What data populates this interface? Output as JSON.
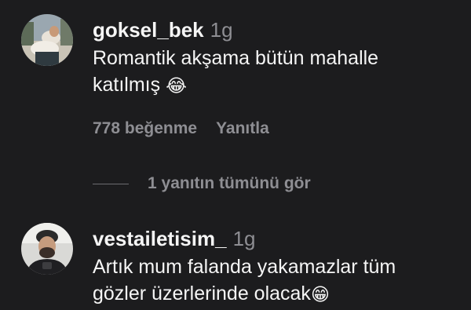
{
  "comments": [
    {
      "username": "goksel_bek",
      "time": "1g",
      "text_line1": "Romantik akşama bütün mahalle",
      "text_line2": "katılmış",
      "emoji": "😂",
      "likes": "778 beğenme",
      "reply_label": "Yanıtla",
      "avatar_icon": "person-avatar-icon"
    },
    {
      "username": "vestailetisim_",
      "time": "1g",
      "text_line1": "Artık mum falanda yakamazlar tüm",
      "text_line2": "gözler üzerlerinde olacak",
      "emoji": "😁",
      "avatar_icon": "person-avatar-icon"
    }
  ],
  "view_replies": "1 yanıtın tümünü gör",
  "colors": {
    "background": "#1c1c1e",
    "primary_text": "#f5f5f5",
    "secondary_text": "#8e8e93"
  }
}
